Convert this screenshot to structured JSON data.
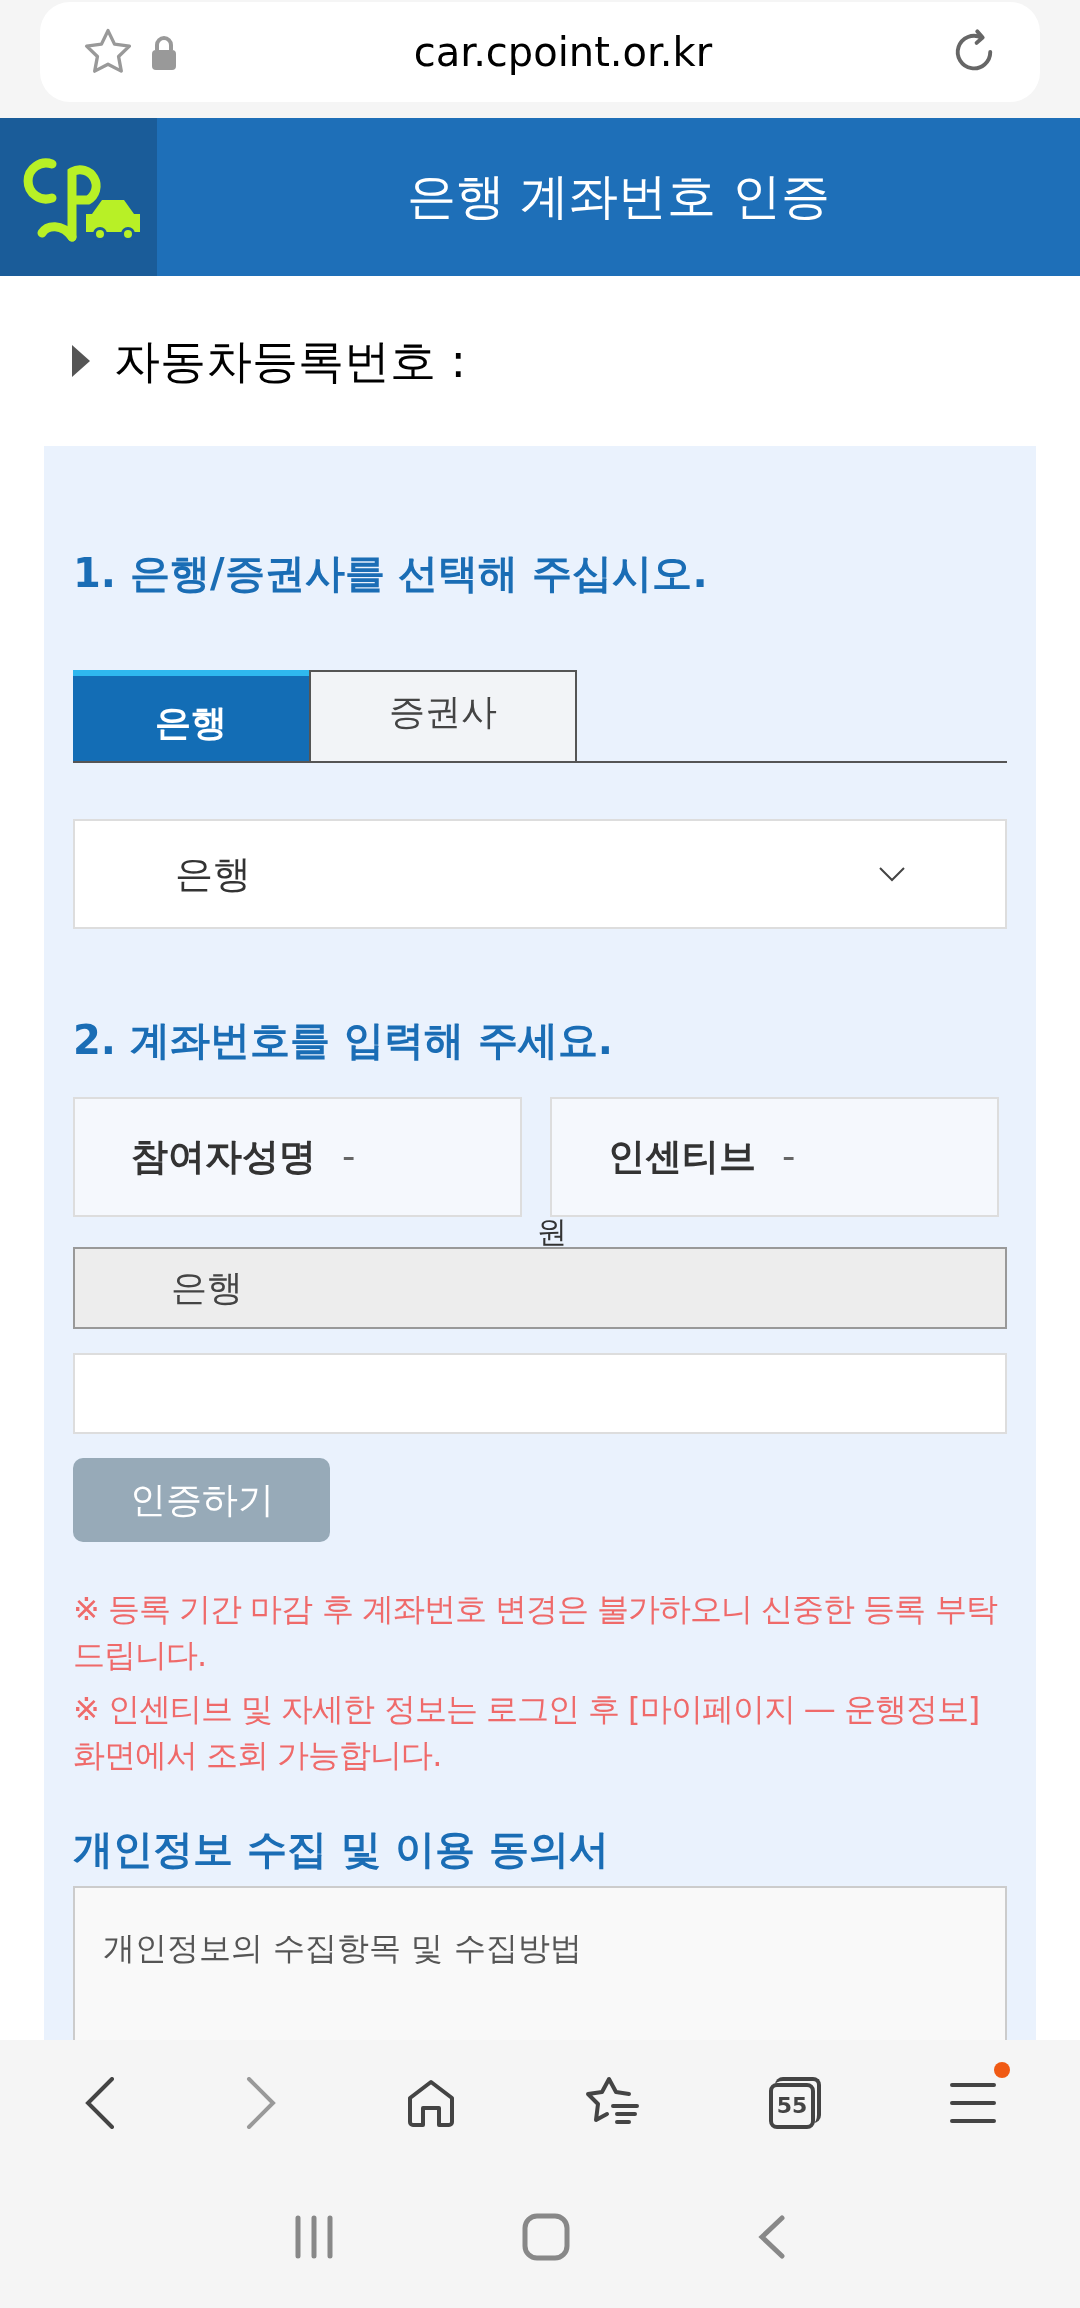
{
  "browser": {
    "url": "car.cpoint.or.kr"
  },
  "header": {
    "title": "은행 계좌번호 인증"
  },
  "car_number": {
    "label": "자동차등록번호 :"
  },
  "step1": {
    "heading": "1. 은행/증권사를 선택해 주십시오.",
    "tabs": [
      {
        "label": "은행",
        "selected": true
      },
      {
        "label": "증권사",
        "selected": false
      }
    ],
    "select": {
      "value": "은행"
    }
  },
  "step2": {
    "heading": "2. 계좌번호를 입력해 주세요.",
    "info": [
      {
        "label": "참여자성명",
        "separator": "-"
      },
      {
        "label": "인센티브",
        "separator": "-"
      }
    ],
    "unit": "원",
    "bank_field": {
      "value": "은행"
    },
    "verify_button": {
      "label": "인증하기",
      "disabled": true
    }
  },
  "notices": [
    "※ 등록 기간 마감 후 계좌번호 변경은 불가하오니 신중한 등록 부탁 드립니다.",
    "※ 인센티브 및 자세한 정보는 로그인 후 [마이페이지 — 운행정보] 화면에서 조회 가능합니다."
  ],
  "consent": {
    "heading": "개인정보 수집 및 이용 동의서",
    "text": "개인정보의 수집항목 및 수집방법"
  },
  "toolbar": {
    "tab_count": "55",
    "menu_badge": true
  }
}
